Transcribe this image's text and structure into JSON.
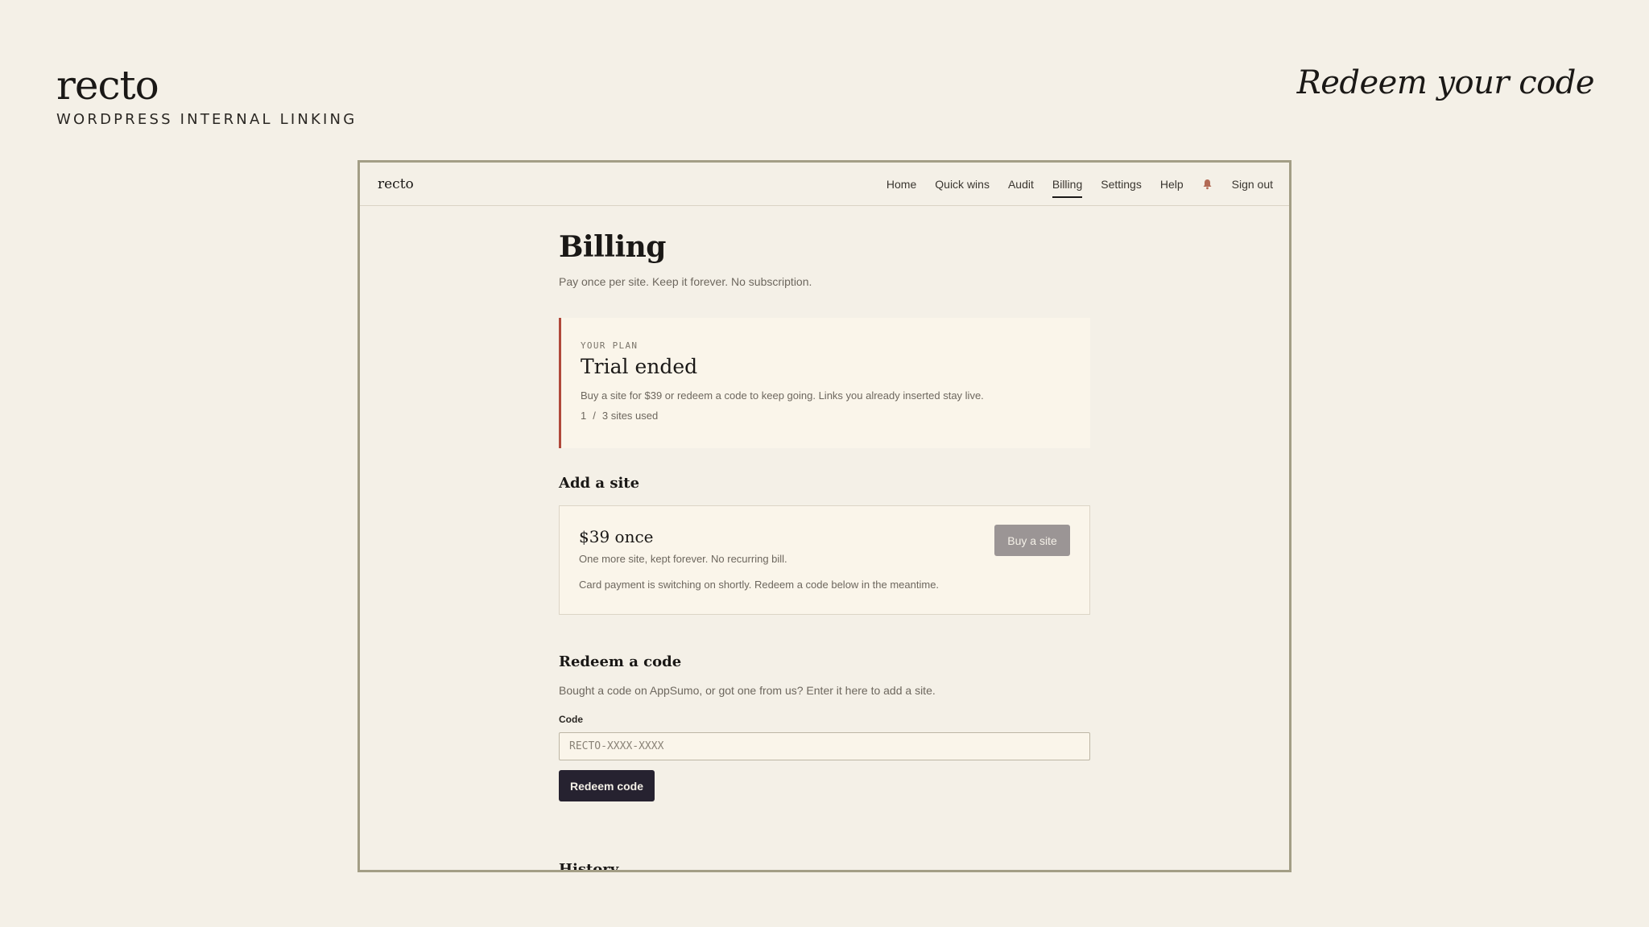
{
  "brand": {
    "name": "recto",
    "tagline": "WORDPRESS INTERNAL LINKING"
  },
  "headline": "Redeem your code",
  "app": {
    "logo": "recto",
    "nav": [
      {
        "label": "Home"
      },
      {
        "label": "Quick wins"
      },
      {
        "label": "Audit"
      },
      {
        "label": "Billing",
        "active": true
      },
      {
        "label": "Settings"
      },
      {
        "label": "Help"
      }
    ],
    "notification_icon": "bell-icon",
    "sign_out": "Sign out"
  },
  "billing": {
    "title": "Billing",
    "subtitle": "Pay once per site. Keep it forever. No subscription.",
    "plan": {
      "eyebrow": "YOUR PLAN",
      "status": "Trial ended",
      "description": "Buy a site for $39 or redeem a code to keep going. Links you already inserted stay live.",
      "used": "1",
      "separator": "/",
      "total": "3 sites used"
    },
    "add_site": {
      "title": "Add a site",
      "price": "$39 once",
      "description": "One more site, kept forever. No recurring bill.",
      "note": "Card payment is switching on shortly. Redeem a code below in the meantime.",
      "button": "Buy a site"
    },
    "redeem": {
      "title": "Redeem a code",
      "description": "Bought a code on AppSumo, or got one from us? Enter it here to add a site.",
      "label": "Code",
      "placeholder": "RECTO-XXXX-XXXX",
      "button": "Redeem code"
    },
    "history_title": "History"
  },
  "colors": {
    "background": "#f4f0e7",
    "accent_border": "#b0483a",
    "primary_button": "#262230",
    "disabled_button": "#9b9595",
    "frame_border": "#a39e86"
  }
}
